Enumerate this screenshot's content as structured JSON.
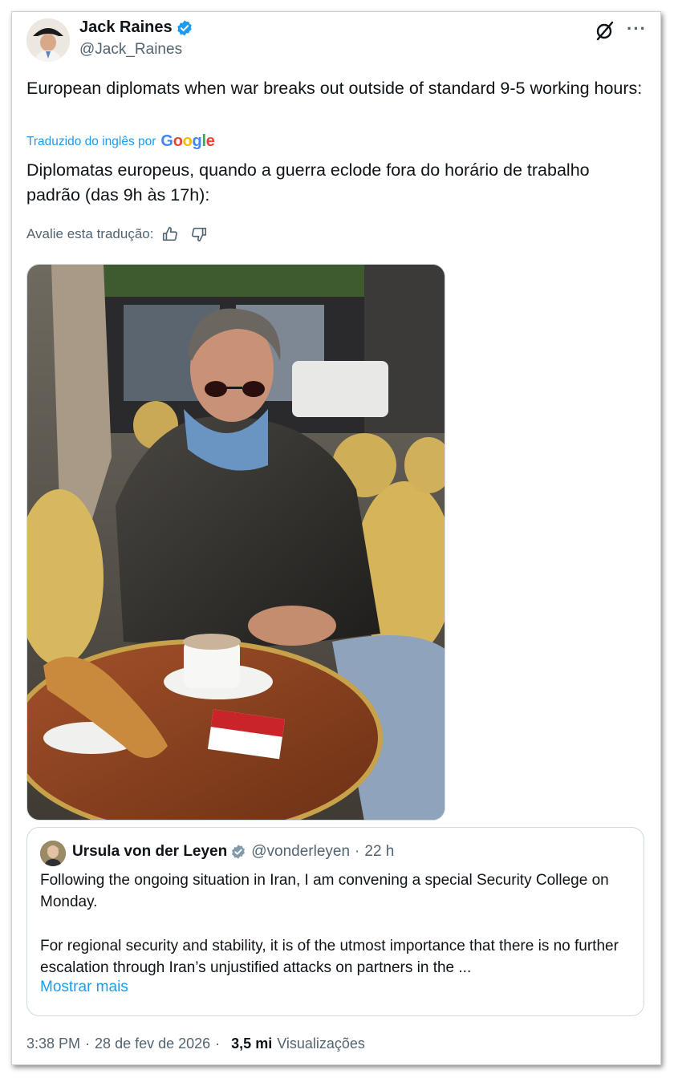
{
  "post": {
    "author_name": "Jack Raines",
    "author_handle": "@Jack_Raines",
    "original_text": "European diplomats when war breaks out outside of standard 9-5 working hours:",
    "translated_by_label": "Traduzido do inglês por",
    "translator_brand": "Google",
    "translated_text": "Diplomatas europeus, quando a guerra eclode fora do horário de trabalho padrão (das 9h às 17h):",
    "rate_translation_label": "Avalie esta tradução:",
    "icons": [
      "verified-badge-icon",
      "grok-icon",
      "more-icon",
      "thumbs-up-icon",
      "thumbs-down-icon"
    ]
  },
  "quoted": {
    "author_name": "Ursula von der Leyen",
    "author_handle": "@vonderleyen",
    "separator": "·",
    "time": "22 h",
    "text_p1": "Following the ongoing situation in Iran, I am convening a special Security College on Monday.",
    "text_p2": "For regional security and stability, it is of the utmost importance that there is no further escalation through Iran’s unjustified attacks on partners in the ...",
    "show_more": "Mostrar mais"
  },
  "footer": {
    "time": "3:38 PM",
    "separator": "·",
    "date": "28 de fev de 2026",
    "views_count": "3,5 mi",
    "views_label": "Visualizações"
  },
  "colors": {
    "link_blue": "#1d9bf0",
    "secondary_text": "#536471",
    "primary_text": "#0f1419",
    "border": "#cfd9de"
  }
}
